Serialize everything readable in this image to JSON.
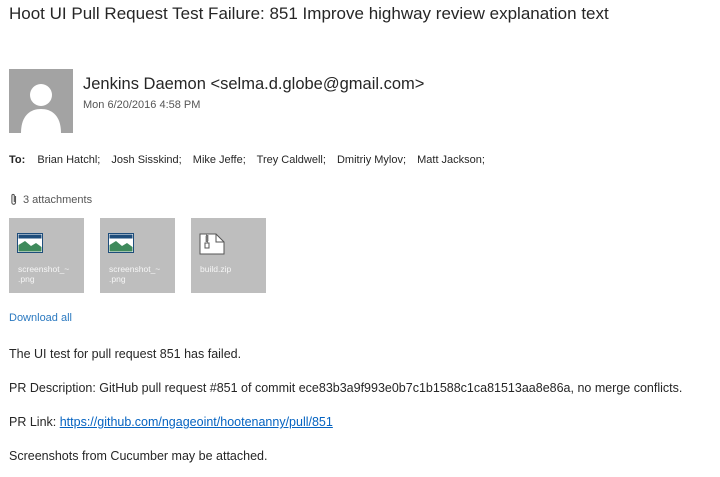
{
  "subject": "Hoot UI Pull Request Test Failure: 851 Improve highway review explanation text",
  "sender": {
    "display": "Jenkins Daemon <selma.d.globe@gmail.com>",
    "date": "Mon 6/20/2016 4:58 PM",
    "avatar_icon": "person-silhouette-icon"
  },
  "to": {
    "label": "To:",
    "recipients": [
      "Brian Hatchl;",
      "Josh Sisskind;",
      "Mike Jeffe;",
      "Trey Caldwell;",
      "Dmitriy Mylov;",
      "Matt Jackson;"
    ]
  },
  "attachments": {
    "header": "3 attachments",
    "items": [
      {
        "name": "screenshot_~\n.png",
        "icon": "image-file-icon"
      },
      {
        "name": "screenshot_~\n.png",
        "icon": "image-file-icon"
      },
      {
        "name": "build.zip",
        "icon": "zip-file-icon"
      }
    ],
    "download_all": "Download all"
  },
  "body": {
    "line1": "The UI test for pull request 851 has failed.",
    "line2": "PR Description: GitHub pull request #851 of commit ece83b3a9f993e0b7c1b1588c1ca81513aa8e86a, no merge conflicts.",
    "pr_link_label": "PR Link: ",
    "pr_link_url": "https://github.com/ngageoint/hootenanny/pull/851",
    "line4": "Screenshots from Cucumber may be attached."
  },
  "colors": {
    "link": "#0563c1",
    "download_link": "#2b79c0",
    "tile_bg": "#bebebe",
    "avatar_bg": "#a3a3a3"
  }
}
